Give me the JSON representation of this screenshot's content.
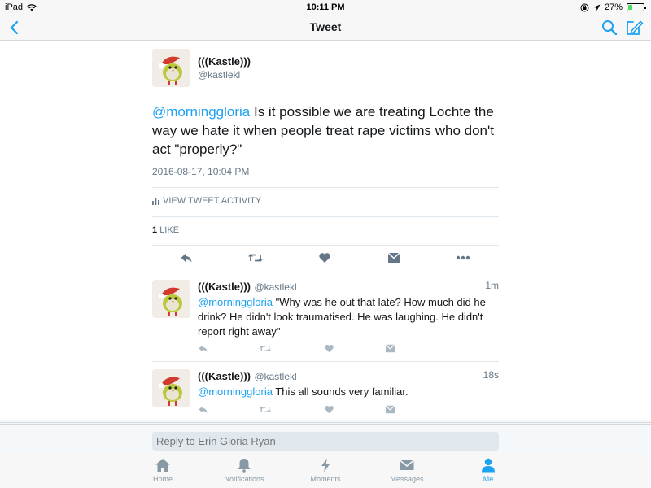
{
  "status_bar": {
    "device": "iPad",
    "time": "10:11 PM",
    "battery": "27%",
    "battery_level": 0.27
  },
  "nav": {
    "title": "Tweet"
  },
  "tweet": {
    "author_name": "(((Kastle)))",
    "author_handle": "@kastlekl",
    "mention": "@morninggloria",
    "text": " Is it possible we are treating Lochte the way we hate it when people treat rape victims who don't act \"properly?\"",
    "timestamp": "2016-08-17, 10:04 PM",
    "activity_label": "VIEW TWEET ACTIVITY",
    "likes_count": "1",
    "likes_label": "LIKE"
  },
  "replies": [
    {
      "name": "(((Kastle)))",
      "handle": "@kastlekl",
      "time": "1m",
      "mention": "@morninggloria",
      "text": " \"Why was he out that late? How much did he drink? He didn't look traumatised. He was laughing. He didn't report right away\""
    },
    {
      "name": "(((Kastle)))",
      "handle": "@kastlekl",
      "time": "18s",
      "mention": "@morninggloria",
      "text": " This all sounds very familiar."
    }
  ],
  "composer": {
    "placeholder": "Reply to Erin Gloria Ryan"
  },
  "tabs": [
    {
      "label": "Home",
      "icon": "home-icon"
    },
    {
      "label": "Notifications",
      "icon": "bell-icon"
    },
    {
      "label": "Moments",
      "icon": "lightning-icon"
    },
    {
      "label": "Messages",
      "icon": "envelope-icon"
    },
    {
      "label": "Me",
      "icon": "person-icon"
    }
  ],
  "colors": {
    "accent": "#1da1f2",
    "muted": "#8899a6",
    "text": "#14171a"
  }
}
